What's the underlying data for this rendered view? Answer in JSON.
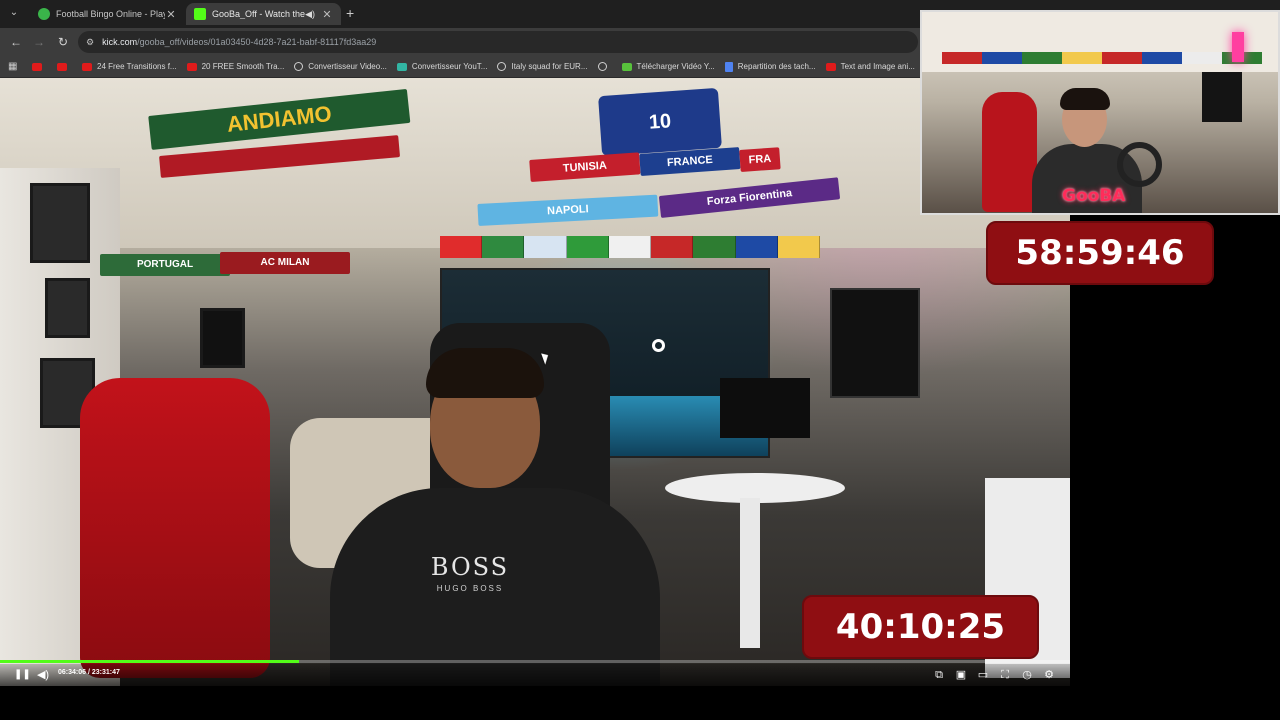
{
  "browser": {
    "tabs": [
      {
        "title": "Football Bingo Online - Play No",
        "active": false,
        "favicon_color": "#3ab54a"
      },
      {
        "title": "GooBa_Off - Watch the VOD",
        "active": true,
        "favicon_color": "#53fc18"
      }
    ],
    "url_host": "kick.com",
    "url_path": "/gooba_off/videos/01a03450-4d28-7a21-babf-81117fd3aa29"
  },
  "bookmarks": [
    {
      "label": "",
      "icon": "youtube-icon"
    },
    {
      "label": "",
      "icon": "youtube-icon"
    },
    {
      "label": "24 Free Transitions f...",
      "icon": "youtube-icon"
    },
    {
      "label": "20 FREE Smooth Tra...",
      "icon": "youtube-icon"
    },
    {
      "label": "Convertisseur Video...",
      "icon": "globe-icon"
    },
    {
      "label": "Convertisseur YouT...",
      "icon": "teal-icon"
    },
    {
      "label": "Italy squad for EUR...",
      "icon": "globe-icon"
    },
    {
      "label": "",
      "icon": "globe-icon"
    },
    {
      "label": "Télécharger Vidéo Y...",
      "icon": "download-icon"
    },
    {
      "label": "Repartition des tach...",
      "icon": "doc-icon"
    },
    {
      "label": "Text and Image ani...",
      "icon": "youtube-icon"
    }
  ],
  "video": {
    "scarves": {
      "andiamo": "ANDIAMO",
      "tunisia": "TUNISIA",
      "france": "FRANCE",
      "fra": "FRA",
      "napoli": "NAPOLI",
      "fiorentina": "Forza Fiorentina",
      "portugal": "PORTUGAL",
      "acmilan": "AC MILAN",
      "jersey": "10"
    },
    "shirt_brand": "BOSS",
    "shirt_sub": "HUGO BOSS",
    "timer_bottom": "40:10:25",
    "time_display": "06:34:06 / 23:31:47",
    "progress_fraction": 0.279
  },
  "webcam": {
    "logo_text": "GooBA"
  },
  "timer_top": "58:59:46",
  "colors": {
    "kick_green": "#53fc18",
    "timer_red": "#8f0e12"
  }
}
